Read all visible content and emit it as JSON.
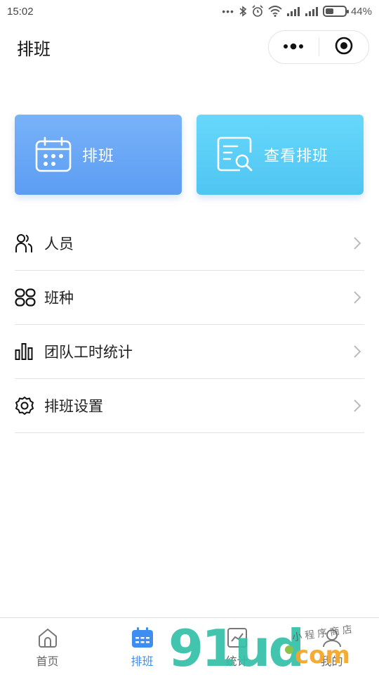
{
  "status_bar": {
    "time": "15:02",
    "dots": "•••",
    "battery_percent": "44%",
    "battery_level": 0.44
  },
  "nav": {
    "title": "排班",
    "capsule_more_icon": "more-dots-icon",
    "capsule_close_icon": "target-circle-icon"
  },
  "actions": [
    {
      "label": "排班",
      "icon": "calendar-icon",
      "color_top": "#78b2f8",
      "color_bottom": "#5c9df3"
    },
    {
      "label": "查看排班",
      "icon": "document-search-icon",
      "color_top": "#67d8fb",
      "color_bottom": "#4fc5f2"
    }
  ],
  "menu": [
    {
      "label": "人员",
      "icon": "people-icon"
    },
    {
      "label": "班种",
      "icon": "grid-rounded-icon"
    },
    {
      "label": "团队工时统计",
      "icon": "bar-chart-icon"
    },
    {
      "label": "排班设置",
      "icon": "gear-icon"
    }
  ],
  "tabs": [
    {
      "label": "首页",
      "icon": "home-icon",
      "active": false
    },
    {
      "label": "排班",
      "icon": "calendar-icon",
      "active": true
    },
    {
      "label": "统计",
      "icon": "chart-icon",
      "active": false
    },
    {
      "label": "我的",
      "icon": "user-icon",
      "active": false
    }
  ],
  "colors": {
    "accent": "#3d8ef0",
    "tab_inactive": "#666666",
    "divider": "#e2e2e2"
  },
  "watermark": {
    "main": "91ud",
    "com": "com",
    "sub": "小程序商店"
  }
}
